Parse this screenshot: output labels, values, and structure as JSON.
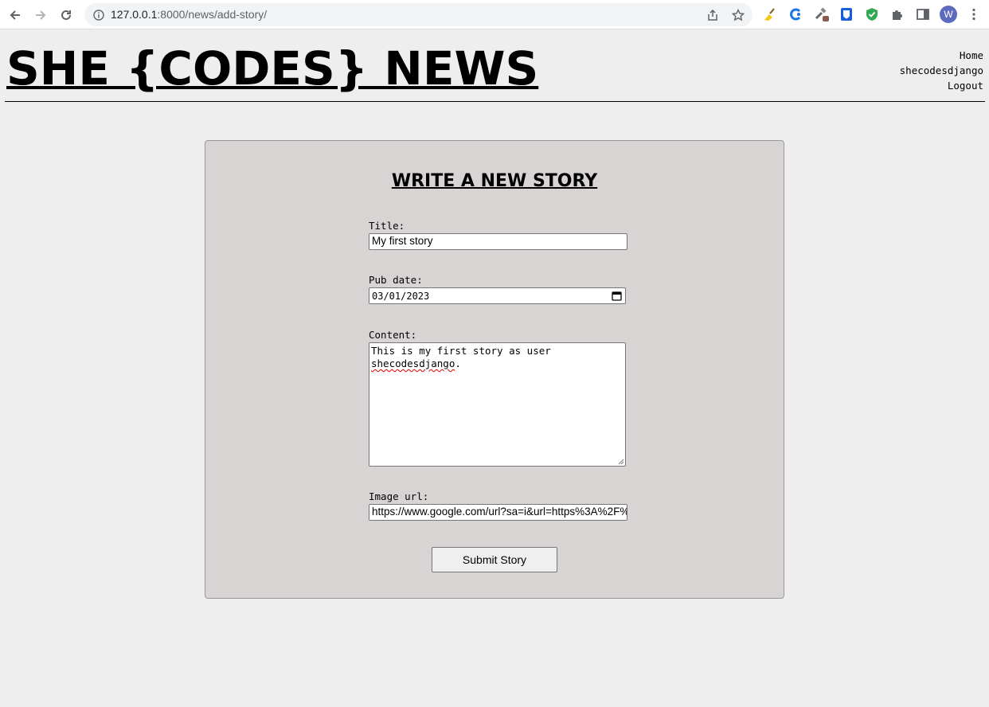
{
  "browser": {
    "url_host": "127.0.0.1",
    "url_rest": ":8000/news/add-story/",
    "profile_initial": "W"
  },
  "header": {
    "site_title": "SHE {CODES} NEWS",
    "nav": [
      {
        "label": "Home"
      },
      {
        "label": "shecodesdjango"
      },
      {
        "label": "Logout"
      }
    ]
  },
  "form": {
    "heading": "WRITE A NEW STORY",
    "title_label": "Title:",
    "title_value": "My first story",
    "pub_date_label": "Pub date:",
    "pub_date_value": "03/01/2023",
    "content_label": "Content:",
    "content_line1": "This is my first story as user",
    "content_word": "shecodesdjango",
    "content_tail": ".",
    "image_label": "Image url:",
    "image_value": "https://www.google.com/url?sa=i&url=https%3A%2F%",
    "submit_label": "Submit Story"
  },
  "colors": {
    "page_bg": "#eeeeee",
    "panel_bg": "#d8d4d4",
    "avatar": "#5c6bc0"
  }
}
